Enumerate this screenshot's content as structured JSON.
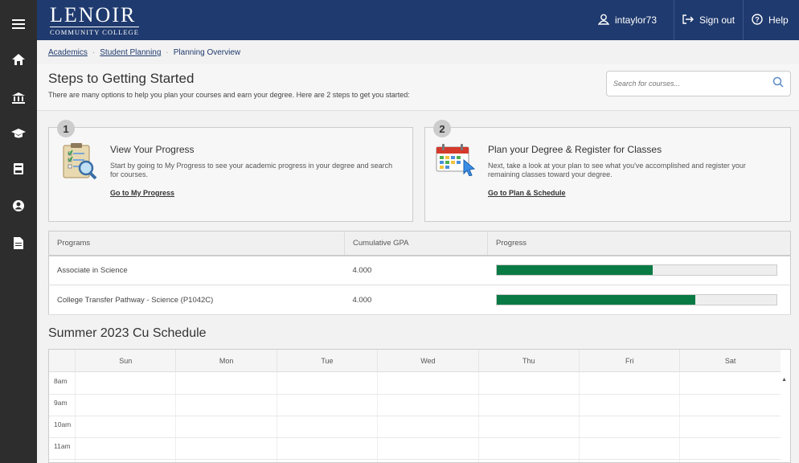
{
  "sidebar": {
    "items": [
      {
        "name": "menu-icon",
        "glyph": "≡"
      },
      {
        "name": "home-icon",
        "glyph": "⌂"
      },
      {
        "name": "institution-icon",
        "glyph": "🏛"
      },
      {
        "name": "graduation-cap-icon",
        "glyph": "🎓"
      },
      {
        "name": "book-icon",
        "glyph": "▮"
      },
      {
        "name": "user-circle-icon",
        "glyph": "◉"
      },
      {
        "name": "document-icon",
        "glyph": "▤"
      }
    ]
  },
  "header": {
    "logo_main": "LENOIR",
    "logo_sub": "COMMUNITY COLLEGE",
    "username": "intaylor73",
    "sign_out": "Sign out",
    "help": "Help"
  },
  "breadcrumb": {
    "items": [
      "Academics",
      "Student Planning",
      "Planning Overview"
    ]
  },
  "page": {
    "title": "Steps to Getting Started",
    "subtitle": "There are many options to help you plan your courses and earn your degree. Here are 2 steps to get you started:"
  },
  "search": {
    "placeholder": "Search for courses..."
  },
  "steps": [
    {
      "number": "1",
      "title": "View Your Progress",
      "description": "Start by going to My Progress to see your academic progress in your degree and search for courses.",
      "link": "Go to My Progress"
    },
    {
      "number": "2",
      "title": "Plan your Degree & Register for Classes",
      "description": "Next, take a look at your plan to see what you've accomplished and register your remaining classes toward your degree.",
      "link": "Go to Plan & Schedule"
    }
  ],
  "programs": {
    "headers": [
      "Programs",
      "Cumulative GPA",
      "Progress"
    ],
    "rows": [
      {
        "program": "Associate in Science",
        "gpa": "4.000",
        "progress": 0.56
      },
      {
        "program": "College Transfer Pathway - Science (P1042C)",
        "gpa": "4.000",
        "progress": 0.71
      }
    ]
  },
  "schedule": {
    "title": "Summer 2023 Cu Schedule",
    "days": [
      "Sun",
      "Mon",
      "Tue",
      "Wed",
      "Thu",
      "Fri",
      "Sat"
    ],
    "hours": [
      "8am",
      "9am",
      "10am",
      "11am"
    ]
  },
  "colors": {
    "topbar": "#1f3a6e",
    "sidebar": "#2d2d2d",
    "progress_fill": "#0a7a45"
  }
}
